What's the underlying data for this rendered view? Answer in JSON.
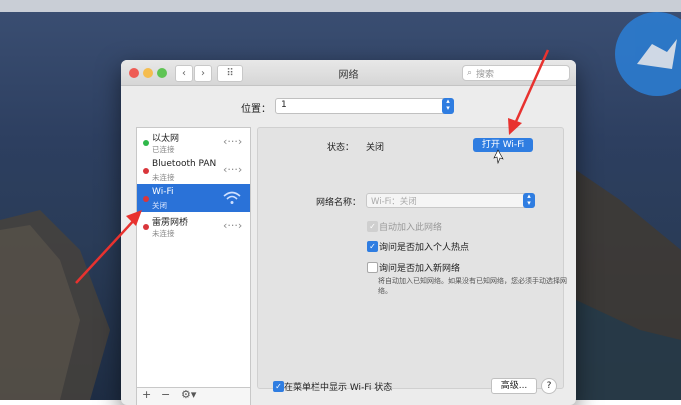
{
  "window": {
    "title": "网络",
    "search_placeholder": "搜索",
    "grid_icon": "grid-icon"
  },
  "location": {
    "label": "位置：",
    "value": "1"
  },
  "sidebar": {
    "items": [
      {
        "name": "以太网",
        "status": "已连接",
        "dot_color": "#2fb84a",
        "icon": "ethernet-arrows-icon"
      },
      {
        "name": "Bluetooth PAN",
        "status": "未连接",
        "dot_color": "#d9363b",
        "icon": "ethernet-arrows-icon"
      },
      {
        "name": "Wi-Fi",
        "status": "关闭",
        "dot_color": "#d9363b",
        "icon": "wifi-icon"
      },
      {
        "name": "雷雳网桥",
        "status": "未连接",
        "dot_color": "#d9363b",
        "icon": "ethernet-arrows-icon"
      }
    ],
    "toolbar": {
      "add": "+",
      "remove": "−",
      "gear": "⚙▾"
    }
  },
  "detail": {
    "status_label": "状态：",
    "status_value": "关闭",
    "turn_on_button": "打开 Wi-Fi",
    "network_name_label": "网络名称：",
    "network_name_value": "Wi-Fi：关闭",
    "options": [
      {
        "label": "自动加入此网络",
        "checked": true,
        "disabled": true
      },
      {
        "label": "询问是否加入个人热点",
        "checked": true,
        "disabled": false
      },
      {
        "label": "询问是否加入新网络",
        "checked": false,
        "disabled": false
      }
    ],
    "note": "将自动加入已知网络。如果没有已知网络，您必须手动选择网络。"
  },
  "bottom": {
    "show_wifi_label": "在菜单栏中显示 Wi-Fi 状态",
    "show_wifi_checked": true,
    "advanced_button": "高级...",
    "help_button": "?"
  },
  "colors": {
    "accent": "#2f7de1",
    "selection": "#2a72d8",
    "arrow": "#e8322f"
  }
}
